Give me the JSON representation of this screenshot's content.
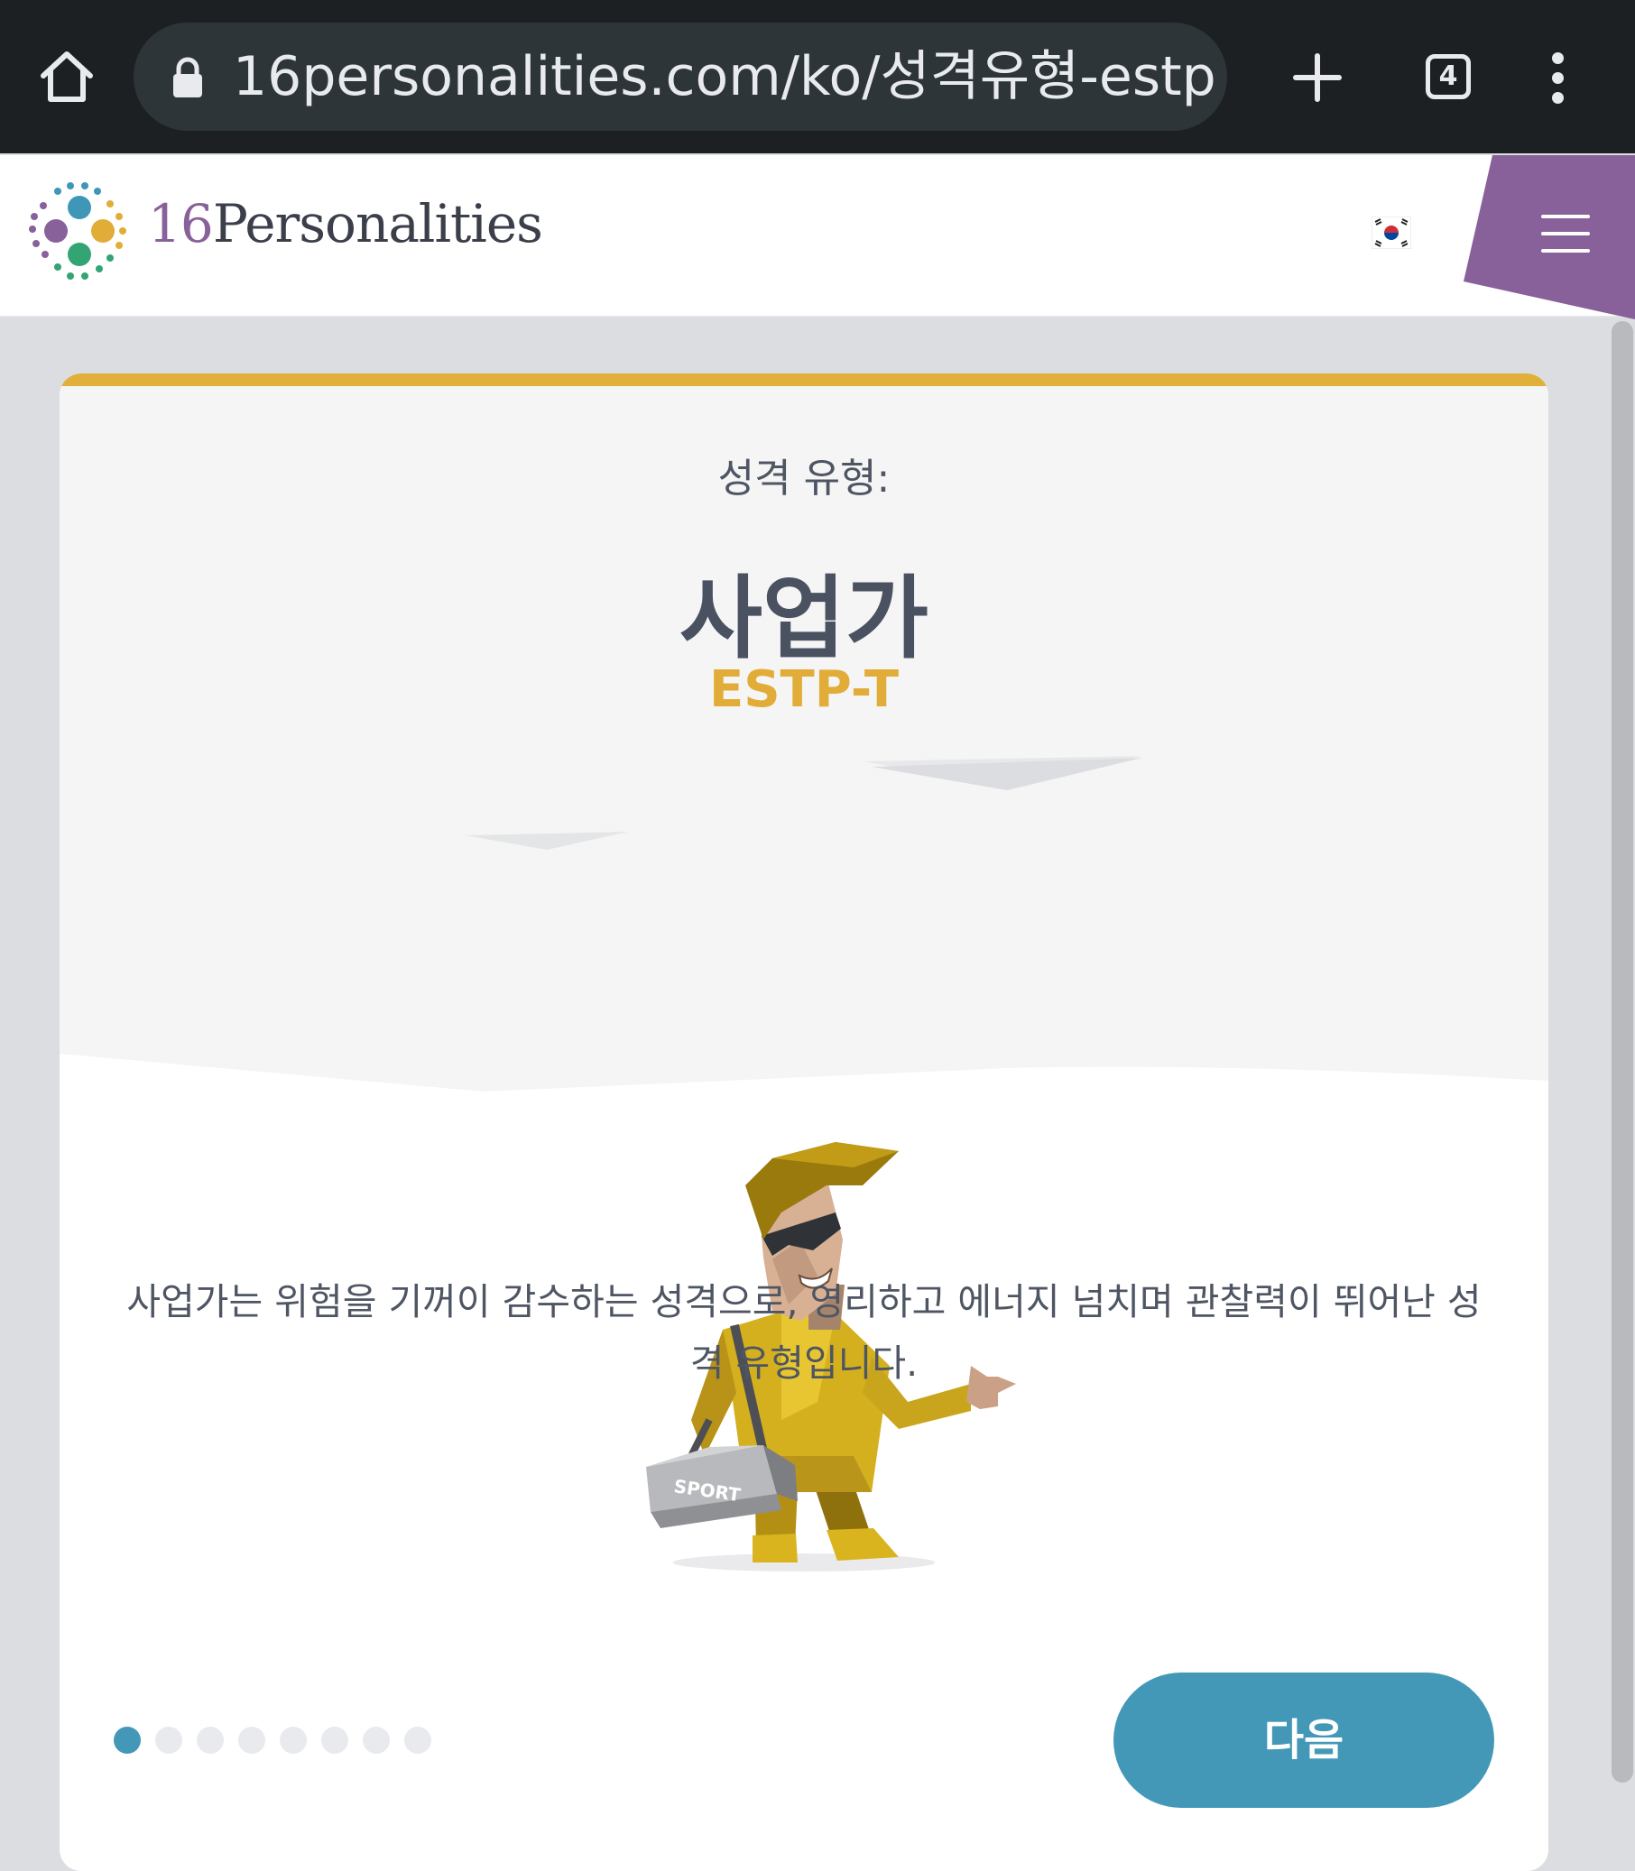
{
  "browser": {
    "url": "16personalities.com/ko/성격유형-estp",
    "tab_count": "4"
  },
  "header": {
    "logo_num": "16",
    "logo_word": "Personalities",
    "language_flag": "korea-flag-icon",
    "menu_icon": "hamburger-icon",
    "accent_color": "#88619a"
  },
  "card": {
    "kicker": "성격 유형:",
    "type_name": "사업가",
    "type_code": "ESTP-T",
    "bag_label": "SPORT",
    "description": "사업가는 위험을 기꺼이 감수하는 성격으로, 영리하고 에너지 넘치며 관찰력이 뛰어난 성격 유형입니다.",
    "accent_color": "#e0b03a",
    "pager": {
      "total": 8,
      "active": 1
    },
    "next_label": "다음",
    "button_color": "#4398b7"
  }
}
